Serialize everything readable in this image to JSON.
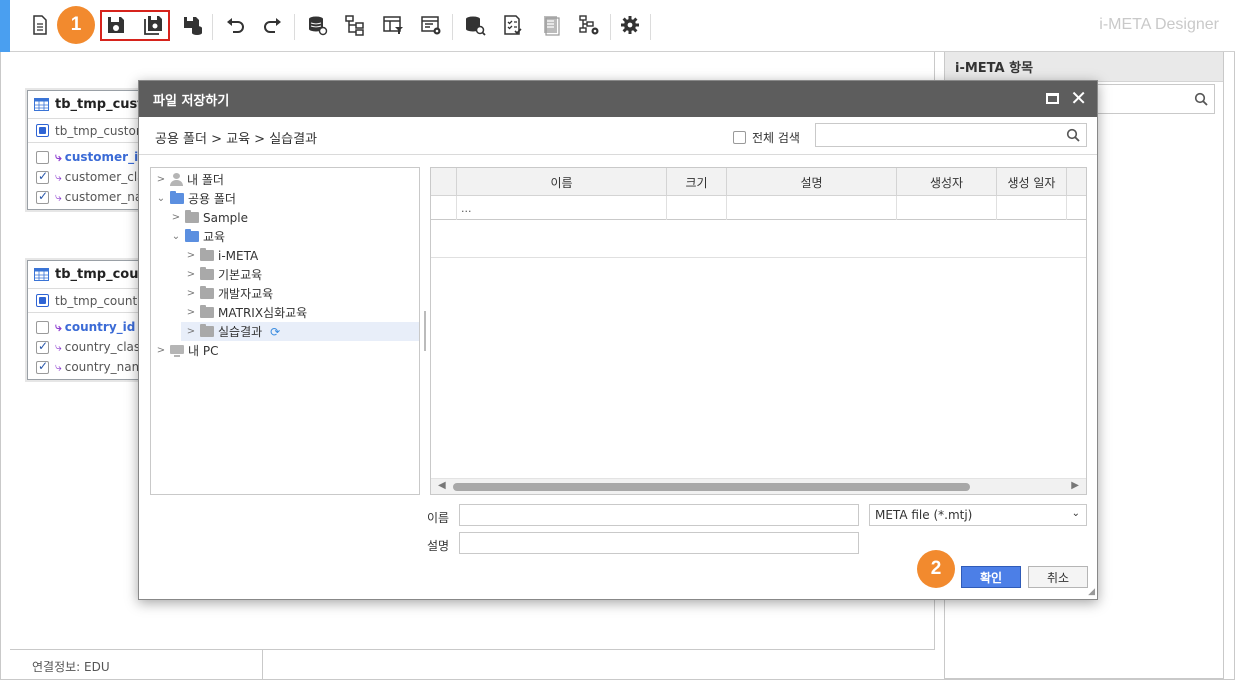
{
  "app": {
    "title": "i-META Designer"
  },
  "toolbar": {
    "items": [
      {
        "name": "new-document-icon"
      },
      {
        "name": "save-icon"
      },
      {
        "name": "save-as-icon"
      },
      {
        "name": "save-db-icon"
      },
      {
        "name": "undo-icon"
      },
      {
        "name": "redo-icon"
      },
      {
        "name": "database-link-icon"
      },
      {
        "name": "hierarchy-icon"
      },
      {
        "name": "table-filter-icon"
      },
      {
        "name": "table-settings-icon"
      },
      {
        "name": "database-search-icon"
      },
      {
        "name": "checklist-icon"
      },
      {
        "name": "document-icon"
      },
      {
        "name": "tree-settings-icon"
      },
      {
        "name": "gear-icon"
      }
    ],
    "badge1": "1"
  },
  "workspace": {
    "tables": [
      {
        "name": "tb_tmp_custo",
        "sub": "tb_tmp_custom",
        "columns": [
          {
            "label": "customer_id",
            "pk": true,
            "checked": false
          },
          {
            "label": "customer_cla",
            "pk": false,
            "checked": true
          },
          {
            "label": "customer_na",
            "pk": false,
            "checked": true
          }
        ]
      },
      {
        "name": "tb_tmp_coun",
        "sub": "tb_tmp_country",
        "columns": [
          {
            "label": "country_id",
            "pk": true,
            "checked": false
          },
          {
            "label": "country_class",
            "pk": false,
            "checked": true
          },
          {
            "label": "country_nam",
            "pk": false,
            "checked": true
          }
        ]
      }
    ]
  },
  "status": {
    "connection": "연결정보: EDU"
  },
  "right_panel": {
    "title": "i-META 항목",
    "search_value": ""
  },
  "dialog": {
    "title": "파일 저장하기",
    "path": "공용 폴더 > 교육 > 실습결과",
    "full_search_label": "전체 검색",
    "search_value": "",
    "tree": [
      {
        "label": "내 폴더",
        "icon": "user",
        "expanded": false,
        "selected": false
      },
      {
        "label": "공용 폴더",
        "icon": "folder-blue",
        "expanded": true,
        "selected": false
      },
      {
        "label": "Sample",
        "icon": "folder-gray",
        "expanded": false,
        "selected": false
      },
      {
        "label": "교육",
        "icon": "folder-blue",
        "expanded": true,
        "selected": false
      },
      {
        "label": "i-META",
        "icon": "folder-gray",
        "expanded": false,
        "selected": false
      },
      {
        "label": "기본교육",
        "icon": "folder-gray",
        "expanded": false,
        "selected": false
      },
      {
        "label": "개발자교육",
        "icon": "folder-gray",
        "expanded": false,
        "selected": false
      },
      {
        "label": "MATRIX심화교육",
        "icon": "folder-gray",
        "expanded": false,
        "selected": false
      },
      {
        "label": "실습결과",
        "icon": "folder-gray",
        "expanded": false,
        "selected": true
      },
      {
        "label": "내 PC",
        "icon": "pc",
        "expanded": false,
        "selected": false
      }
    ],
    "grid": {
      "headers": [
        "이름",
        "크기",
        "설명",
        "생성자",
        "생성 일자"
      ],
      "rows": [
        [
          "...",
          "",
          "",
          "",
          ""
        ]
      ]
    },
    "form": {
      "name_label": "이름",
      "name_value": "",
      "desc_label": "설명",
      "desc_value": "",
      "file_type": "META file (*.mtj)"
    },
    "ok_label": "확인",
    "cancel_label": "취소",
    "badge2": "2"
  },
  "colors": {
    "accent": "#4a9ff0",
    "badge": "#f28a2e",
    "highlight_border": "#d6231c",
    "primary_button": "#4c7fe7",
    "title_bar": "#5d5d5d"
  }
}
